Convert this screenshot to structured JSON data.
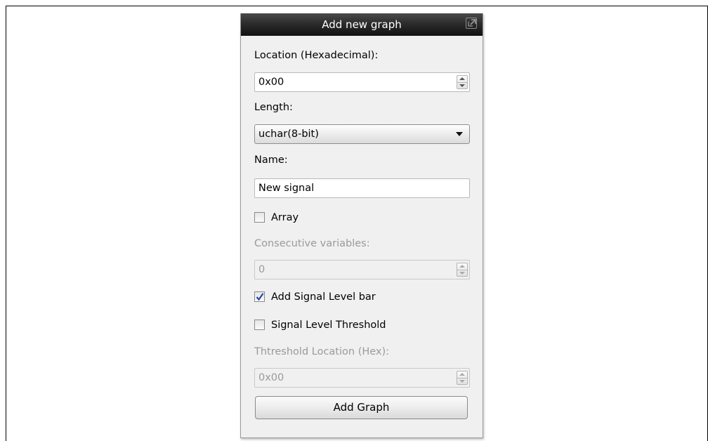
{
  "dialog": {
    "title": "Add new graph",
    "undock_icon": "undock-icon"
  },
  "location": {
    "label": "Location (Hexadecimal):",
    "value": "0x00"
  },
  "length": {
    "label": "Length:",
    "selected": "uchar(8-bit)"
  },
  "name": {
    "label": "Name:",
    "value": "New signal"
  },
  "array": {
    "label": "Array",
    "checked": false
  },
  "consecutive": {
    "label": "Consecutive variables:",
    "value": "0"
  },
  "signal_level_bar": {
    "label": "Add Signal Level bar",
    "checked": true
  },
  "signal_level_threshold": {
    "label": "Signal Level Threshold",
    "checked": false
  },
  "threshold_location": {
    "label": "Thtreshold Location (Hex):",
    "value": "0x00"
  },
  "add_button": {
    "label": "Add Graph"
  },
  "colors": {
    "titlebar": "#2c2c2c",
    "panel": "#f0f0f0",
    "disabled_text": "#9a9a9a",
    "check_mark": "#1f4aa8"
  }
}
